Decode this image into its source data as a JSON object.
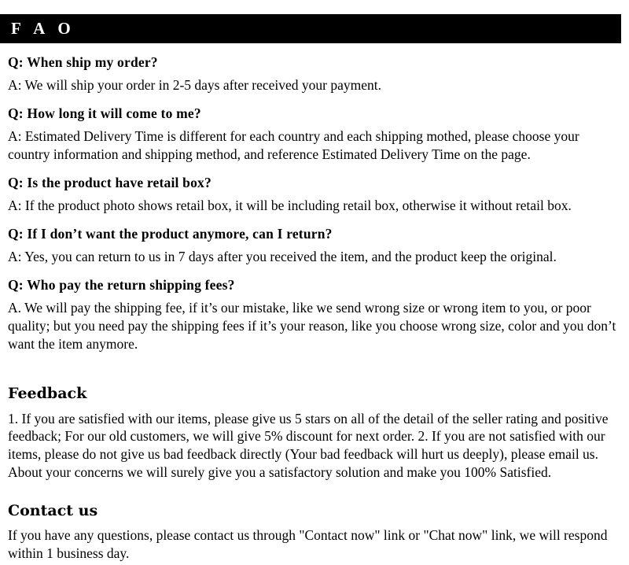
{
  "banner": {
    "title": "F A O"
  },
  "faq": {
    "items": [
      {
        "question": "Q: When ship my order?",
        "answer": "A: We will ship your order in 2-5 days after received your payment."
      },
      {
        "question": "Q: How long it will come to me?",
        "answer": "A: Estimated Delivery Time is different for each country and each shipping mothed, please choose your country information and shipping method, and reference Estimated Delivery Time on the page."
      },
      {
        "question": "Q: Is the product have retail box?",
        "answer": "A: If  the product photo shows retail box, it will be including retail box, otherwise it without retail box."
      },
      {
        "question": "Q: If I don’t want the product anymore, can I return?",
        "answer": "A: Yes, you can return to us in 7 days after you received the item, and the product keep the original."
      },
      {
        "question": "Q: Who pay the return shipping fees?",
        "answer": "A.  We will pay the shipping fee, if  it’s our mistake, like we send wrong size or wrong item to you, or poor quality; but you need pay the shipping fees if  it’s your reason, like you choose wrong size, color and you don’t want the item anymore."
      }
    ]
  },
  "feedback": {
    "heading": "Feedback",
    "paragraph": "1.  If you are satisfied with our items, please give us 5 stars on all of the detail of the seller rating and positive feedback; For our old customers, we will give 5% discount for next order.\n2.  If you are not satisfied with our items, please do not give us bad feedback directly (Your bad feedback will hurt us deeply), please email us. About your concerns we will surely give you a satisfactory solution and make you 100% Satisfied."
  },
  "contact": {
    "heading": "Contact us",
    "paragraph": "If you have any questions, please contact us through \"Contact now\" link or \"Chat now\" link, we will respond within 1 business day."
  },
  "colors": {
    "banner_background": "#000000",
    "banner_text": "#ffffff",
    "page_background": "#ffffff",
    "body_text": "#000000"
  }
}
